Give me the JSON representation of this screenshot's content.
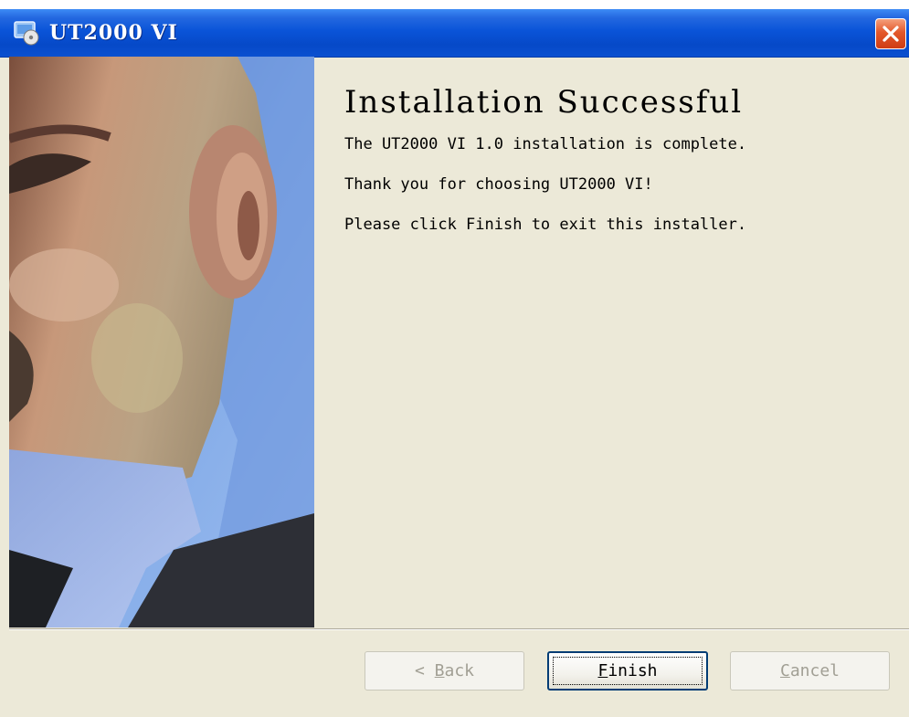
{
  "window": {
    "title": "UT2000 VI",
    "icon": "installer-disc-icon",
    "close_icon": "close-x-icon"
  },
  "side_image": {
    "description_icon": "side-banner-image"
  },
  "content": {
    "heading": "Installation Successful",
    "line1": "The UT2000 VI 1.0 installation is complete.",
    "line2": "Thank you for choosing UT2000 VI!",
    "line3": "Please click Finish to exit this installer."
  },
  "buttons": {
    "back": {
      "prefix": "< ",
      "mnemonic": "B",
      "rest": "ack",
      "enabled": false
    },
    "finish": {
      "mnemonic": "F",
      "rest": "inish",
      "enabled": true,
      "focused": true
    },
    "cancel": {
      "mnemonic": "C",
      "rest": "ancel",
      "enabled": false
    }
  },
  "colors": {
    "titlebar": "#0a54d8",
    "dialog_bg": "#ece9d8",
    "close": "#e3582b"
  }
}
